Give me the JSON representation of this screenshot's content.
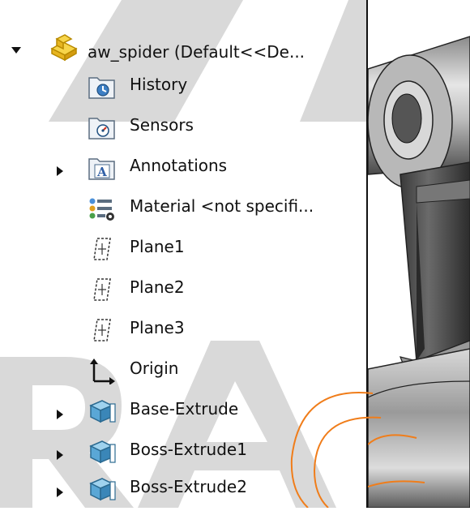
{
  "tree": {
    "root": {
      "label": "aw_spider  (Default<<De...",
      "icon": "part-icon",
      "expanded": true
    },
    "items": [
      {
        "label": "History",
        "icon": "history-folder-icon",
        "has_arrow": false
      },
      {
        "label": "Sensors",
        "icon": "sensors-folder-icon",
        "has_arrow": false
      },
      {
        "label": "Annotations",
        "icon": "annotations-folder-icon",
        "has_arrow": true
      },
      {
        "label": "Material <not specifi...",
        "icon": "material-icon",
        "has_arrow": false
      },
      {
        "label": "Plane1",
        "icon": "plane-icon",
        "has_arrow": false
      },
      {
        "label": "Plane2",
        "icon": "plane-icon",
        "has_arrow": false
      },
      {
        "label": "Plane3",
        "icon": "plane-icon",
        "has_arrow": false
      },
      {
        "label": "Origin",
        "icon": "origin-icon",
        "has_arrow": false
      },
      {
        "label": "Base-Extrude",
        "icon": "extrude-icon",
        "has_arrow": true
      },
      {
        "label": "Boss-Extrude1",
        "icon": "extrude-icon",
        "has_arrow": true
      },
      {
        "label": "Boss-Extrude2",
        "icon": "extrude-icon",
        "has_arrow": true
      }
    ]
  },
  "colors": {
    "selection_outline": "#f07d1a",
    "watermark": "#d3d3d3"
  }
}
